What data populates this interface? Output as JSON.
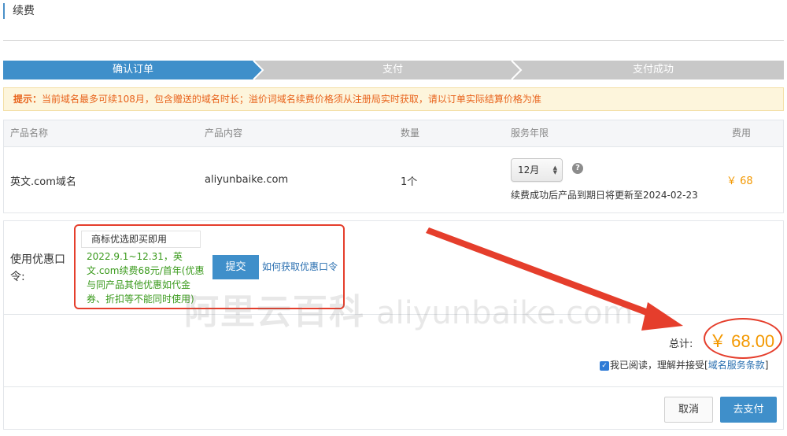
{
  "page": {
    "title": "续费"
  },
  "steps": [
    {
      "label": "确认订单",
      "active": true
    },
    {
      "label": "支付",
      "active": false
    },
    {
      "label": "支付成功",
      "active": false
    }
  ],
  "notice": {
    "prefix": "提示：",
    "text": "当前域名最多可续108月，包含赠送的域名时长；溢价词域名续费价格须从注册局实时获取，请以订单实际结算价格为准"
  },
  "table": {
    "headers": [
      "产品名称",
      "产品内容",
      "数量",
      "服务年限",
      "费用"
    ],
    "row": {
      "product_name": "英文.com域名",
      "content": "aliyunbaike.com",
      "quantity": "1个",
      "term_select": "12月",
      "renew_note": "续费成功后产品到期日将更新至2024-02-23",
      "fee": "￥ 68"
    }
  },
  "coupon": {
    "label": "使用优惠口令:",
    "input_value": "商标优选即买即用",
    "promo_text": "2022.9.1~12.31，英文.com续费68元/首年(优惠与同产品其他优惠如代金券、折扣等不能同时使用)",
    "submit_label": "提交",
    "help_link": "如何获取优惠口令"
  },
  "summary": {
    "total_label": "总计:",
    "total_value": "￥ 68.00",
    "agree_text": "我已阅读，理解并接受[",
    "agree_link": "域名服务条款",
    "agree_close": "]",
    "agree_checked": true
  },
  "actions": {
    "cancel": "取消",
    "pay": "去支付"
  },
  "watermark": {
    "cn": "阿里云百科",
    "latin": "aliyunbaike.com"
  },
  "colors": {
    "primary": "#3f8fca",
    "step_inactive": "#c8c8c8",
    "price": "#f39800",
    "notice_text": "#e8631c",
    "promo": "#3a9a1c",
    "annotation_red": "#e53e2c"
  },
  "icons": [
    "question-circle-icon",
    "select-arrows-icon",
    "checkbox-checked-icon",
    "red-arrow-annotation"
  ]
}
